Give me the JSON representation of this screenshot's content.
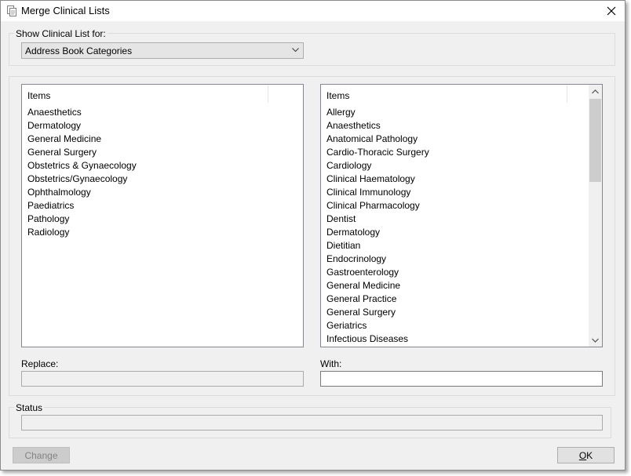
{
  "window": {
    "title": "Merge Clinical Lists"
  },
  "show_group": {
    "label": "Show Clinical List for:",
    "selected": "Address Book Categories"
  },
  "left_list": {
    "header": "Items",
    "items": [
      "Anaesthetics",
      "Dermatology",
      "General Medicine",
      "General Surgery",
      "Obstetrics & Gynaecology",
      "Obstetrics/Gynaecology",
      "Ophthalmology",
      "Paediatrics",
      "Pathology",
      "Radiology"
    ]
  },
  "right_list": {
    "header": "Items",
    "items": [
      "Allergy",
      "Anaesthetics",
      "Anatomical Pathology",
      "Cardio-Thoracic Surgery",
      "Cardiology",
      "Clinical Haematology",
      "Clinical Immunology",
      "Clinical Pharmacology",
      "Dentist",
      "Dermatology",
      "Dietitian",
      "Endocrinology",
      "Gastroenterology",
      "General Medicine",
      "General Practice",
      "General Surgery",
      "Geriatrics",
      "Infectious Diseases"
    ]
  },
  "replace": {
    "label": "Replace:",
    "value": ""
  },
  "with": {
    "label": "With:",
    "value": ""
  },
  "status": {
    "label": "Status",
    "value": ""
  },
  "buttons": {
    "change": "Change",
    "ok_prefix": "",
    "ok_accel": "O",
    "ok_rest": "K"
  },
  "colors": {
    "window_bg": "#f0f0f0",
    "title_bg": "#ffffff",
    "disabled_text": "#838383"
  }
}
